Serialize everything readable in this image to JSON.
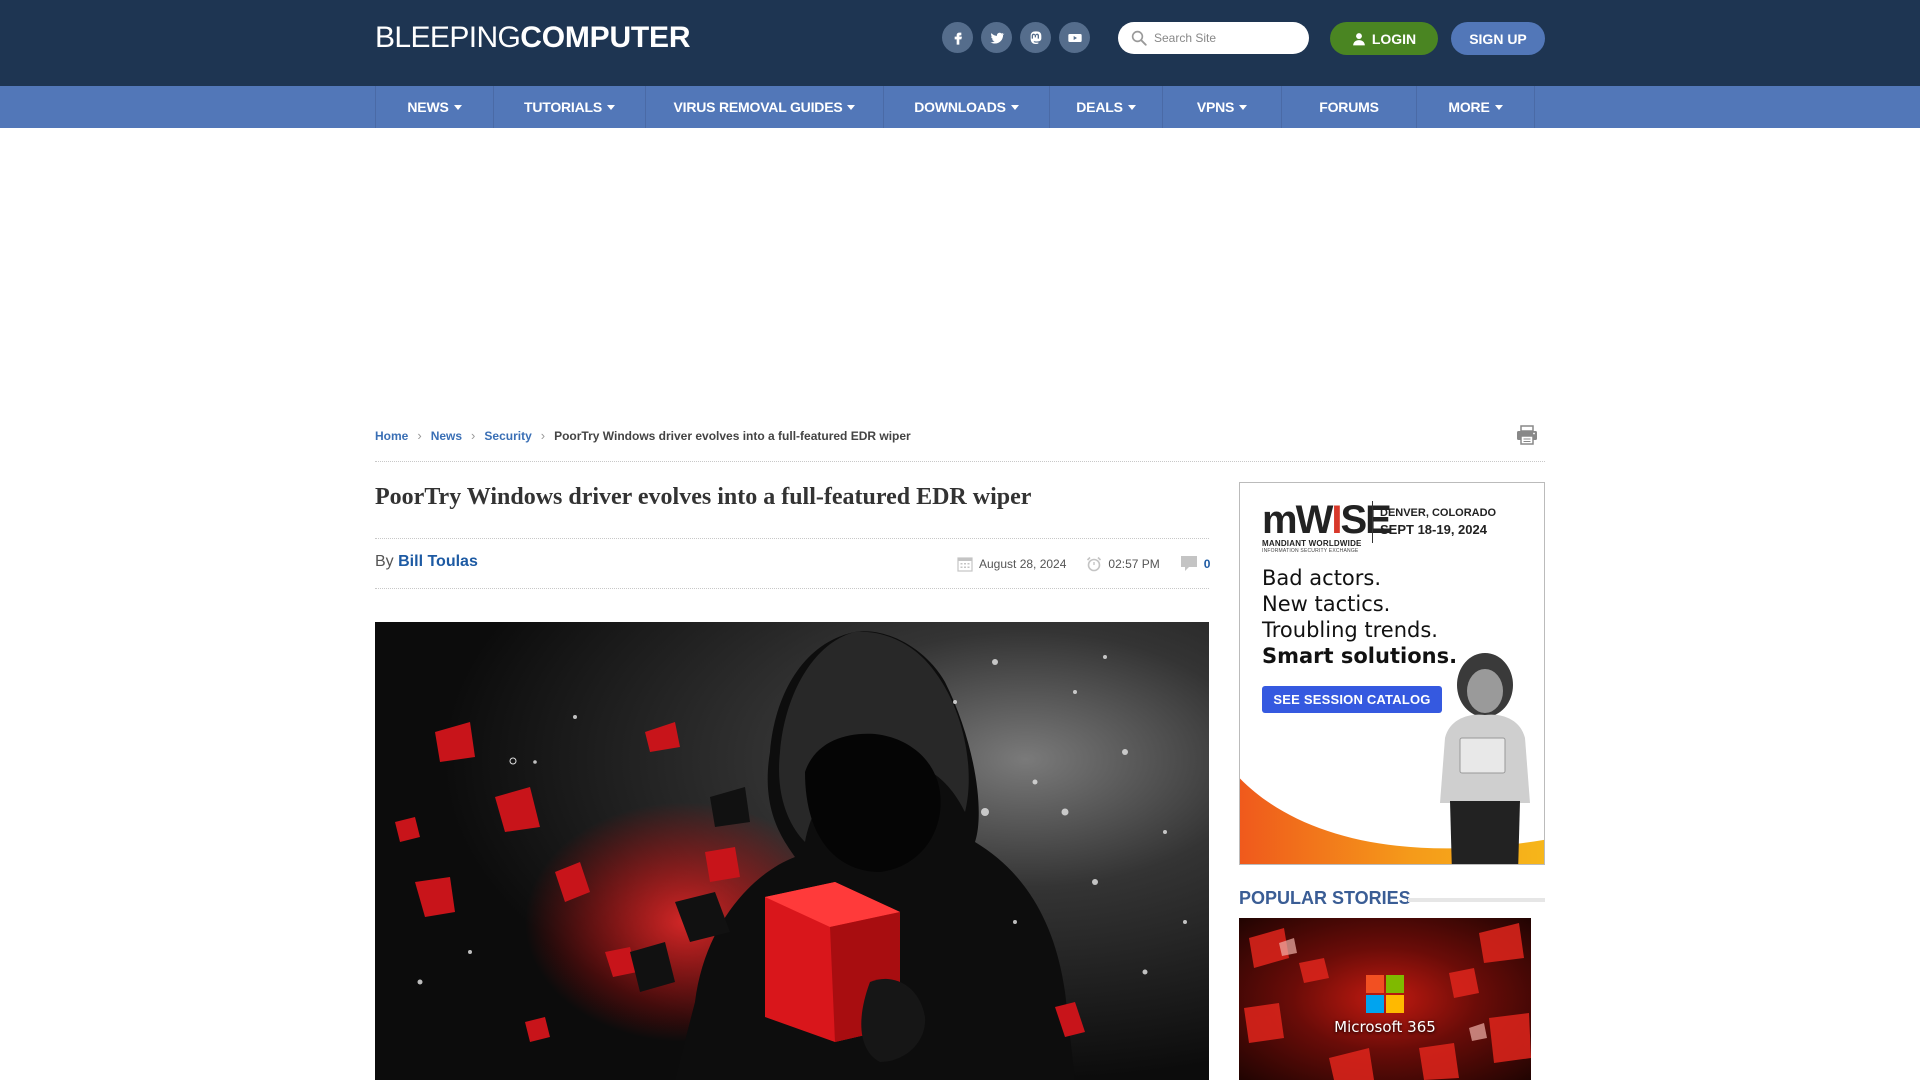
{
  "header": {
    "logo_light": "BLEEPING",
    "logo_bold": "COMPUTER",
    "socials": [
      {
        "name": "facebook-icon"
      },
      {
        "name": "twitter-icon"
      },
      {
        "name": "mastodon-icon"
      },
      {
        "name": "youtube-icon"
      }
    ],
    "search_placeholder": "Search Site",
    "login_label": "LOGIN",
    "signup_label": "SIGN UP"
  },
  "nav": {
    "items": [
      {
        "label": "NEWS",
        "dropdown": true
      },
      {
        "label": "TUTORIALS",
        "dropdown": true
      },
      {
        "label": "VIRUS REMOVAL GUIDES",
        "dropdown": true
      },
      {
        "label": "DOWNLOADS",
        "dropdown": true
      },
      {
        "label": "DEALS",
        "dropdown": true
      },
      {
        "label": "VPNS",
        "dropdown": true
      },
      {
        "label": "FORUMS",
        "dropdown": false
      },
      {
        "label": "MORE",
        "dropdown": true
      }
    ]
  },
  "breadcrumb": {
    "items": [
      "Home",
      "News",
      "Security"
    ],
    "current": "PoorTry Windows driver evolves into a full-featured EDR wiper"
  },
  "article": {
    "title": "PoorTry Windows driver evolves into a full-featured EDR wiper",
    "by_label": "By",
    "author": "Bill Toulas",
    "date": "August 28, 2024",
    "time": "02:57 PM",
    "comments": "0",
    "hero_alt": "Hooded figure holding a shattering red cube"
  },
  "sidebar": {
    "ad": {
      "brand": "mWISE",
      "brand_line1": "MANDIANT WORLDWIDE",
      "brand_line2": "INFORMATION SECURITY EXCHANGE",
      "location": "DENVER, COLORADO",
      "dates": "SEPT 18-19, 2024",
      "copy": [
        "Bad actors.",
        "New tactics.",
        "Troubling trends."
      ],
      "copy_strong": "Smart solutions.",
      "cta": "SEE SESSION CATALOG"
    },
    "popular_title": "POPULAR STORIES",
    "popular_story_image_text": "Microsoft 365"
  },
  "colors": {
    "header_bg": "#1e3552",
    "nav_bg": "#5277b8",
    "login_bg": "#4a8522",
    "signup_bg": "#5277b8",
    "link": "#3a6fb5",
    "author": "#1d5aa3",
    "popular_title": "#3a5d95"
  }
}
